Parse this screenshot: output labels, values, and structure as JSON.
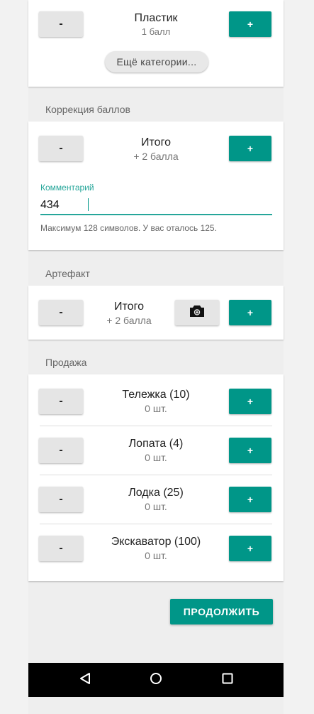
{
  "colors": {
    "accent": "#009688",
    "accent_light": "#26a69a",
    "neutral_button": "#e5e5e5"
  },
  "plastic": {
    "title": "Пластик",
    "subtitle": "1 балл",
    "minus": "-",
    "plus": "+",
    "more": "Ещё категории..."
  },
  "correction": {
    "header": "Коррекция баллов",
    "title": "Итого",
    "subtitle": "+ 2 балла",
    "minus": "-",
    "plus": "+",
    "comment_label": "Комментарий",
    "comment_value": "434",
    "helper": "Максимум 128 символов. У вас оталось 125."
  },
  "artifact": {
    "header": "Артефакт",
    "title": "Итого",
    "subtitle": "+ 2 балла",
    "minus": "-",
    "plus": "+",
    "camera_icon": "camera-icon"
  },
  "sale": {
    "header": "Продажа",
    "items": [
      {
        "title": "Тележка (10)",
        "subtitle": "0 шт.",
        "minus": "-",
        "plus": "+"
      },
      {
        "title": "Лопата (4)",
        "subtitle": "0 шт.",
        "minus": "-",
        "plus": "+"
      },
      {
        "title": "Лодка (25)",
        "subtitle": "0 шт.",
        "minus": "-",
        "plus": "+"
      },
      {
        "title": "Экскаватор (100)",
        "subtitle": "0 шт.",
        "minus": "-",
        "plus": "+"
      }
    ]
  },
  "continue_label": "ПРОДОЛЖИТЬ",
  "navbar": {
    "back": "back-icon",
    "home": "home-icon",
    "recents": "recents-icon"
  }
}
